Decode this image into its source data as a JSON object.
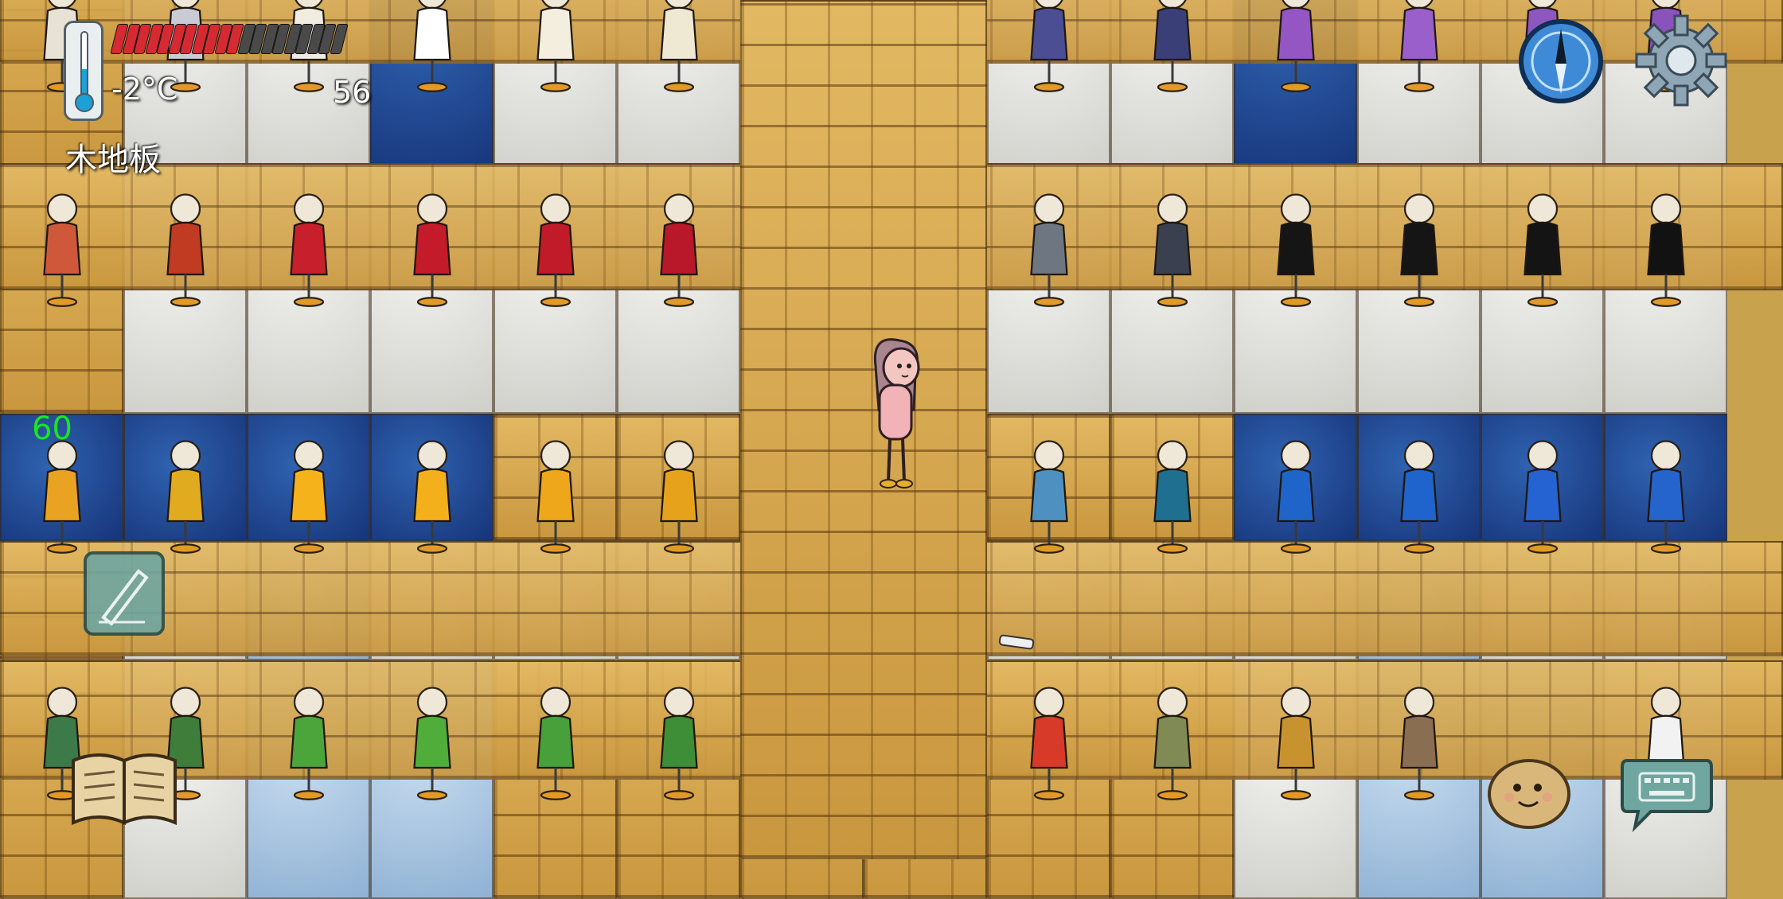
{
  "hud": {
    "temperature": "-2°C",
    "food_counter": "56",
    "ground_label": "木地板",
    "fps": "60",
    "hunger_total_pips": 20,
    "hunger_filled_pips": 11
  },
  "colors": {
    "hunger_filled": "#d62a33",
    "hunger_empty": "#4a4a4a",
    "fps_text": "#19e61e"
  },
  "icons": {
    "thermometer": "thermometer-icon",
    "compass": "compass-icon",
    "settings": "gear-icon",
    "edit": "pencil-icon",
    "tech_book": "book-icon",
    "emote": "emote-face-icon",
    "chat": "keyboard-chat-icon"
  },
  "floor": {
    "rows": [
      [
        "wood",
        "carpet-white",
        "carpet-white",
        "carpet-blue",
        "carpet-white",
        "carpet-white",
        "wood",
        "wood",
        "carpet-white",
        "carpet-white",
        "carpet-blue",
        "carpet-white",
        "carpet-white",
        "carpet-white"
      ],
      [
        "wood",
        "carpet-white",
        "carpet-white",
        "carpet-white",
        "carpet-white",
        "carpet-white",
        "wood",
        "wood",
        "carpet-white",
        "carpet-white",
        "carpet-white",
        "carpet-white",
        "carpet-white",
        "carpet-white"
      ],
      [
        "carpet-blue",
        "carpet-blue",
        "carpet-blue",
        "carpet-blue",
        "wood",
        "wood",
        "wood",
        "wood",
        "wood",
        "wood",
        "carpet-blue",
        "carpet-blue",
        "carpet-blue",
        "carpet-blue"
      ],
      [
        "wood",
        "carpet-white",
        "carpet-light",
        "carpet-white",
        "carpet-white",
        "carpet-white",
        "wood",
        "wood",
        "carpet-white",
        "carpet-white",
        "carpet-white",
        "carpet-light",
        "carpet-white",
        "carpet-white"
      ],
      [
        "wood",
        "carpet-white",
        "carpet-light",
        "carpet-light",
        "wood",
        "wood",
        "wood",
        "wood",
        "wood",
        "wood",
        "carpet-white",
        "carpet-light",
        "carpet-light",
        "carpet-white"
      ]
    ]
  },
  "mannequins": {
    "rows": [
      [
        "#e8e2d6",
        "#c9ccd4",
        "#f1ece0",
        "#ffffff",
        "#f3eede",
        "#efe8d2",
        "",
        "",
        "#4b4e93",
        "#3a3f77",
        "#9356c2",
        "#9a5fcb",
        "#8d56c0",
        "#8a52bb"
      ],
      [
        "#d0583a",
        "#c13a22",
        "#c81f2c",
        "#c41b2a",
        "#c11b29",
        "#b9172a",
        "",
        "",
        "#6e7682",
        "#3b4050",
        "#151515",
        "#151515",
        "#141414",
        "#121212"
      ],
      [
        "#e9a221",
        "#e0ab1e",
        "#f5b21b",
        "#f4b01a",
        "#eea61b",
        "#e7a21c",
        "",
        "",
        "#4e91c0",
        "#1e6f90",
        "#1f64c8",
        "#1f63cc",
        "#2463d1",
        "#2563cd"
      ],
      [
        "#3d7a4a",
        "#3f7d3a",
        "#4ca53b",
        "#50ad3a",
        "#47a03a",
        "#3d8e36",
        "",
        "",
        "#d73a29",
        "#7f8a55",
        "#c8932f",
        "#8a6e52",
        "",
        "#f2f2f2"
      ]
    ]
  }
}
